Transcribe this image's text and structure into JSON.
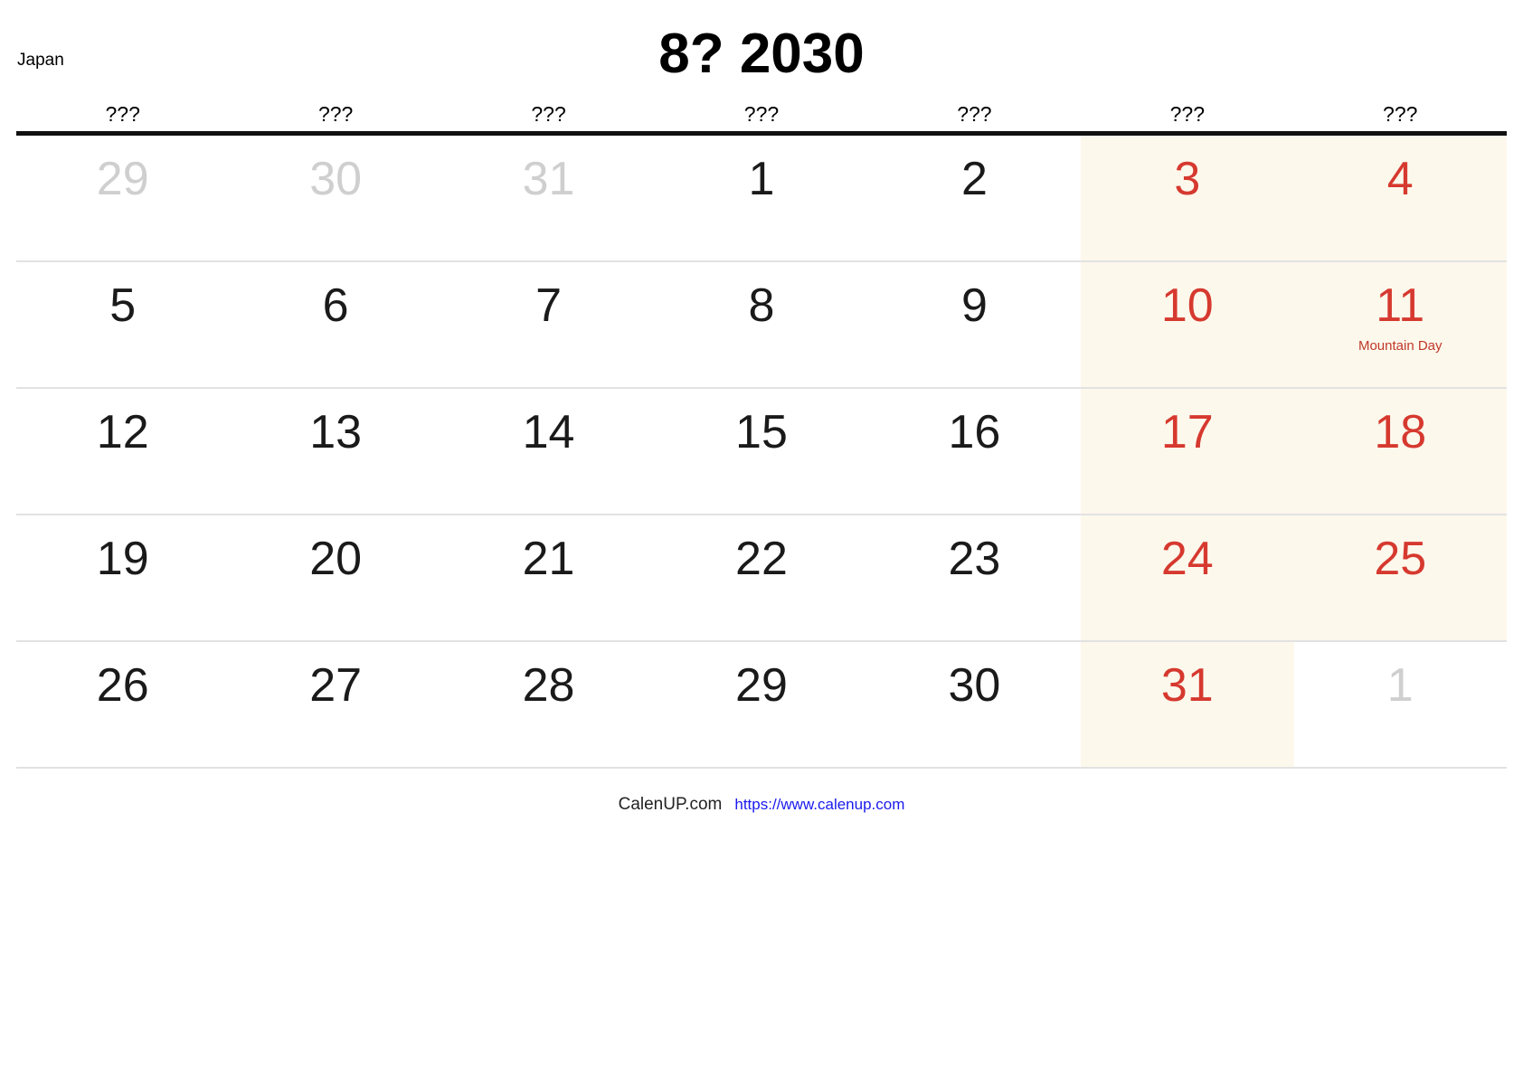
{
  "header": {
    "region_label": "Japan",
    "title": "8? 2030"
  },
  "weekdays": [
    {
      "label": "???"
    },
    {
      "label": "???"
    },
    {
      "label": "???"
    },
    {
      "label": "???"
    },
    {
      "label": "???"
    },
    {
      "label": "???"
    },
    {
      "label": "???"
    }
  ],
  "weeks": [
    {
      "days": [
        {
          "num": "29",
          "kind": "muted",
          "weekend": false,
          "holiday": ""
        },
        {
          "num": "30",
          "kind": "muted",
          "weekend": false,
          "holiday": ""
        },
        {
          "num": "31",
          "kind": "muted",
          "weekend": false,
          "holiday": ""
        },
        {
          "num": "1",
          "kind": "normal",
          "weekend": false,
          "holiday": ""
        },
        {
          "num": "2",
          "kind": "normal",
          "weekend": false,
          "holiday": ""
        },
        {
          "num": "3",
          "kind": "red",
          "weekend": true,
          "holiday": ""
        },
        {
          "num": "4",
          "kind": "red",
          "weekend": true,
          "holiday": ""
        }
      ]
    },
    {
      "days": [
        {
          "num": "5",
          "kind": "normal",
          "weekend": false,
          "holiday": ""
        },
        {
          "num": "6",
          "kind": "normal",
          "weekend": false,
          "holiday": ""
        },
        {
          "num": "7",
          "kind": "normal",
          "weekend": false,
          "holiday": ""
        },
        {
          "num": "8",
          "kind": "normal",
          "weekend": false,
          "holiday": ""
        },
        {
          "num": "9",
          "kind": "normal",
          "weekend": false,
          "holiday": ""
        },
        {
          "num": "10",
          "kind": "red",
          "weekend": true,
          "holiday": ""
        },
        {
          "num": "11",
          "kind": "red",
          "weekend": true,
          "holiday": "Mountain Day"
        }
      ]
    },
    {
      "days": [
        {
          "num": "12",
          "kind": "normal",
          "weekend": false,
          "holiday": ""
        },
        {
          "num": "13",
          "kind": "normal",
          "weekend": false,
          "holiday": ""
        },
        {
          "num": "14",
          "kind": "normal",
          "weekend": false,
          "holiday": ""
        },
        {
          "num": "15",
          "kind": "normal",
          "weekend": false,
          "holiday": ""
        },
        {
          "num": "16",
          "kind": "normal",
          "weekend": false,
          "holiday": ""
        },
        {
          "num": "17",
          "kind": "red",
          "weekend": true,
          "holiday": ""
        },
        {
          "num": "18",
          "kind": "red",
          "weekend": true,
          "holiday": ""
        }
      ]
    },
    {
      "days": [
        {
          "num": "19",
          "kind": "normal",
          "weekend": false,
          "holiday": ""
        },
        {
          "num": "20",
          "kind": "normal",
          "weekend": false,
          "holiday": ""
        },
        {
          "num": "21",
          "kind": "normal",
          "weekend": false,
          "holiday": ""
        },
        {
          "num": "22",
          "kind": "normal",
          "weekend": false,
          "holiday": ""
        },
        {
          "num": "23",
          "kind": "normal",
          "weekend": false,
          "holiday": ""
        },
        {
          "num": "24",
          "kind": "red",
          "weekend": true,
          "holiday": ""
        },
        {
          "num": "25",
          "kind": "red",
          "weekend": true,
          "holiday": ""
        }
      ]
    },
    {
      "days": [
        {
          "num": "26",
          "kind": "normal",
          "weekend": false,
          "holiday": ""
        },
        {
          "num": "27",
          "kind": "normal",
          "weekend": false,
          "holiday": ""
        },
        {
          "num": "28",
          "kind": "normal",
          "weekend": false,
          "holiday": ""
        },
        {
          "num": "29",
          "kind": "normal",
          "weekend": false,
          "holiday": ""
        },
        {
          "num": "30",
          "kind": "normal",
          "weekend": false,
          "holiday": ""
        },
        {
          "num": "31",
          "kind": "red",
          "weekend": true,
          "holiday": ""
        },
        {
          "num": "1",
          "kind": "muted",
          "weekend": false,
          "holiday": ""
        }
      ]
    }
  ],
  "footer": {
    "brand": "CalenUP.com",
    "url": "https://www.calenup.com"
  },
  "colors": {
    "weekend_bg": "#fdf8ec",
    "red": "#d6392f",
    "muted": "#cfcfcf",
    "link": "#1a1aee",
    "rule": "#111111",
    "row_divider": "#e2e2e2"
  }
}
